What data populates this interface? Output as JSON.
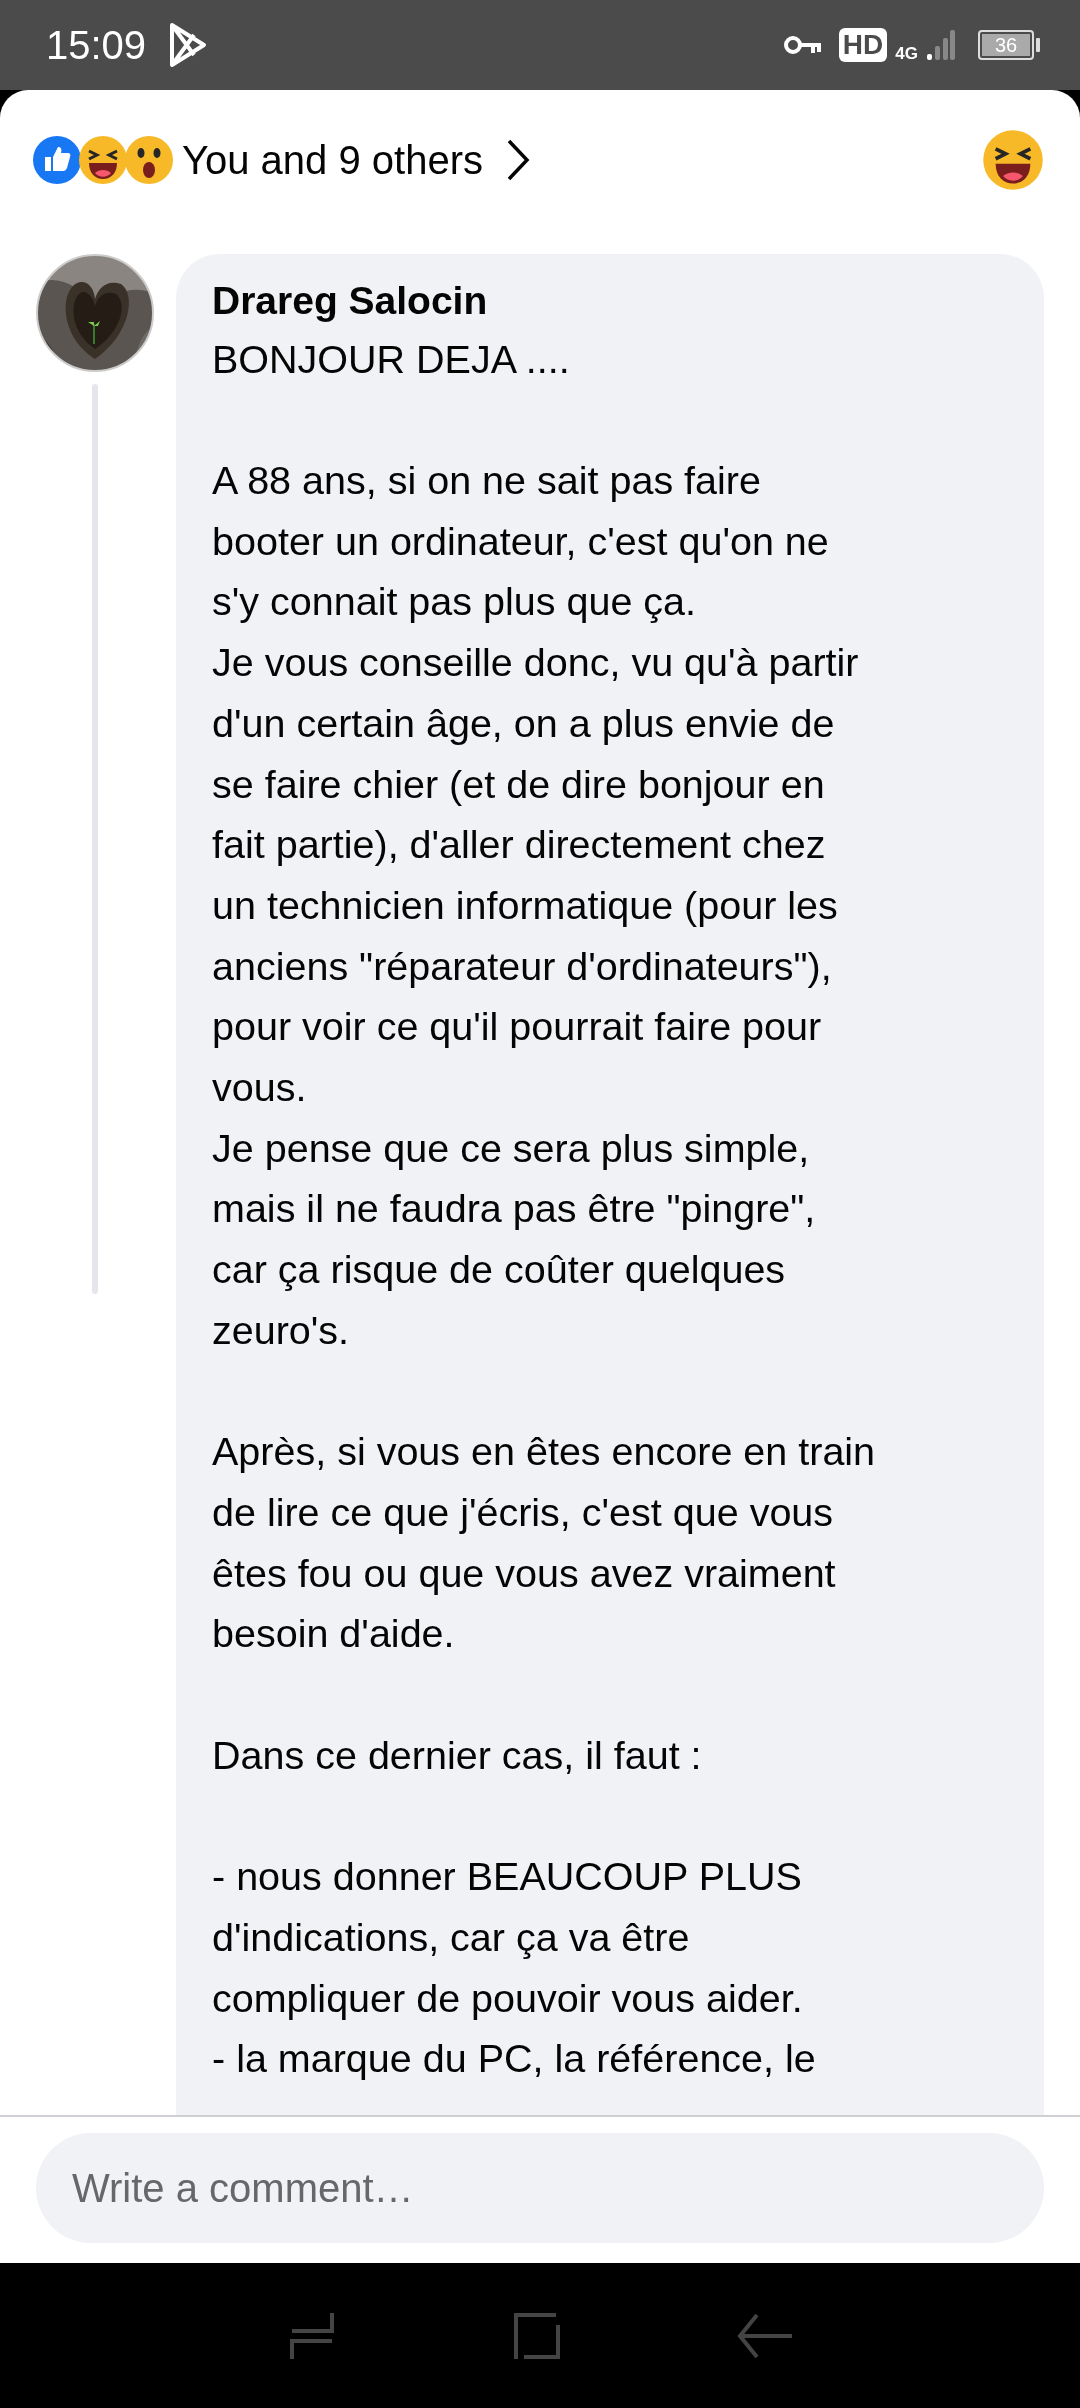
{
  "status_bar": {
    "time": "15:09",
    "hd": "HD",
    "network": "4G",
    "battery": "36"
  },
  "reactions": {
    "summary": "You and 9 others"
  },
  "comment": {
    "author": "Drareg Salocin",
    "paragraphs": [
      {
        "lines": [
          "BONJOUR DEJA ...."
        ]
      },
      {
        "lines": [
          "A 88 ans, si on ne sait pas faire",
          "booter un ordinateur, c'est qu'on ne",
          "s'y connait pas plus que ça.",
          "Je vous conseille donc, vu qu'à partir",
          "d'un certain âge, on a plus envie de",
          "se faire chier (et de dire bonjour en",
          "fait partie), d'aller directement chez",
          "un technicien informatique (pour les",
          "anciens \"réparateur d'ordinateurs\"),",
          "pour voir ce qu'il pourrait faire pour",
          "vous.",
          "Je pense que ce sera plus simple,",
          "mais il ne faudra pas être \"pingre\",",
          "car ça risque de coûter quelques",
          "zeuro's."
        ]
      },
      {
        "lines": [
          "Après, si vous en êtes encore en train",
          "de lire ce que j'écris, c'est que vous",
          "êtes fou ou que vous avez vraiment",
          "besoin d'aide."
        ]
      },
      {
        "lines": [
          "Dans ce dernier cas, il faut :"
        ]
      },
      {
        "lines": [
          "- nous donner BEAUCOUP PLUS",
          "d'indications, car ça va être",
          "compliquer de pouvoir vous aider.",
          "- la marque du PC, la référence, le"
        ]
      }
    ]
  },
  "composer": {
    "placeholder": "Write a comment…"
  }
}
